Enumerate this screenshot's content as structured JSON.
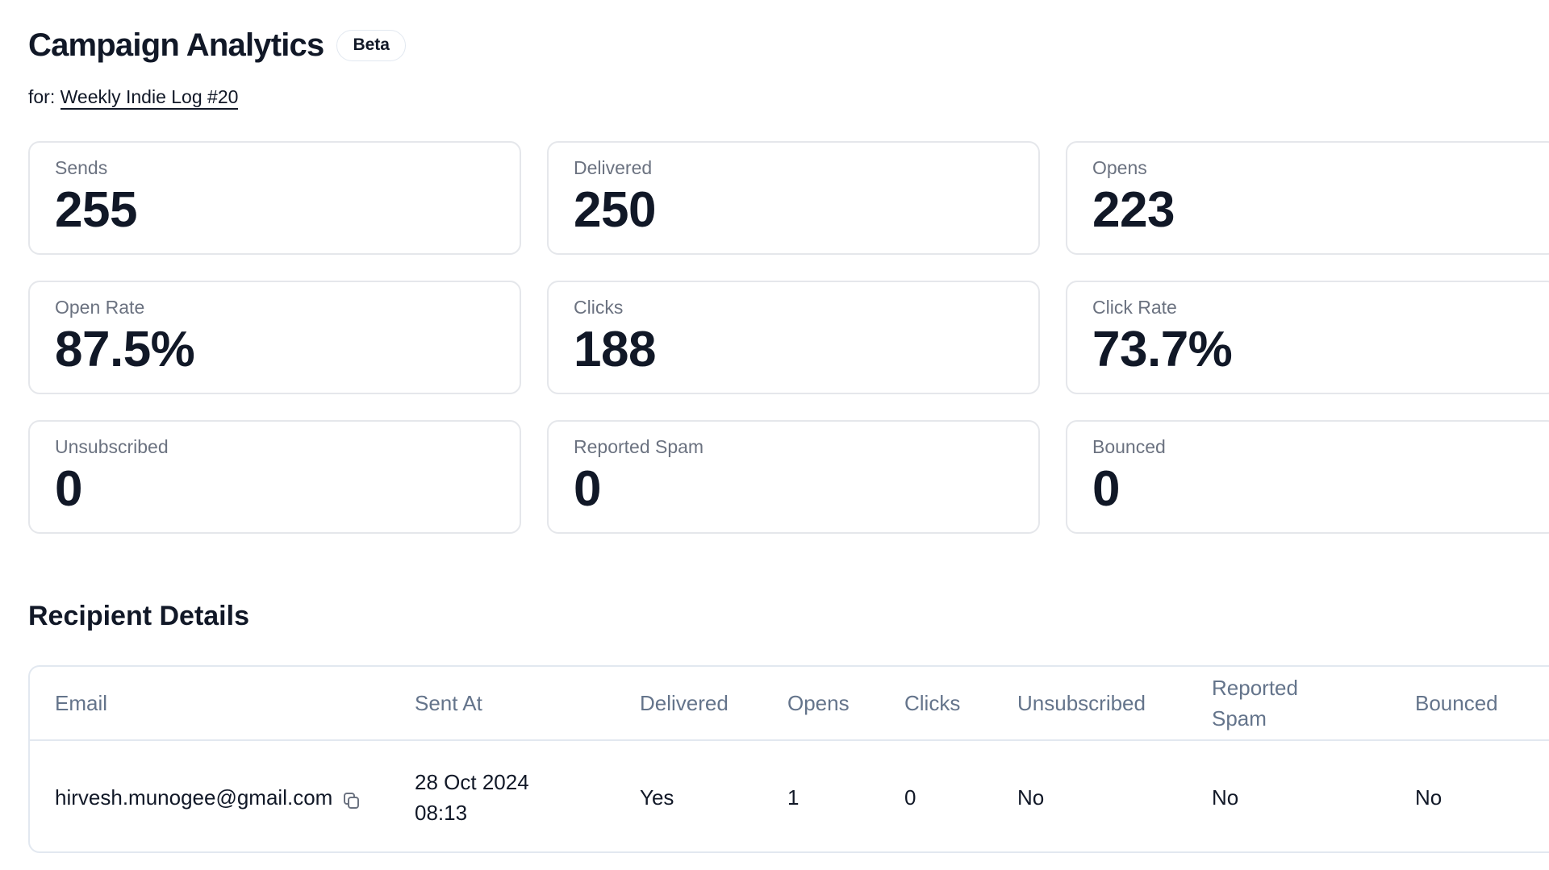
{
  "header": {
    "title": "Campaign Analytics",
    "badge": "Beta",
    "for_prefix": "for:",
    "campaign_link": "Weekly Indie Log #20"
  },
  "stats": [
    {
      "label": "Sends",
      "value": "255"
    },
    {
      "label": "Delivered",
      "value": "250"
    },
    {
      "label": "Opens",
      "value": "223"
    },
    {
      "label": "Open Rate",
      "value": "87.5%"
    },
    {
      "label": "Clicks",
      "value": "188"
    },
    {
      "label": "Click Rate",
      "value": "73.7%"
    },
    {
      "label": "Unsubscribed",
      "value": "0"
    },
    {
      "label": "Reported Spam",
      "value": "0"
    },
    {
      "label": "Bounced",
      "value": "0"
    }
  ],
  "recipients": {
    "title": "Recipient Details",
    "columns": [
      "Email",
      "Sent At",
      "Delivered",
      "Opens",
      "Clicks",
      "Unsubscribed",
      "Reported Spam",
      "Bounced"
    ],
    "rows": [
      {
        "email": "hirvesh.munogee@gmail.com",
        "copy_icon": "copy-icon",
        "sent_at_date": "28 Oct 2024",
        "sent_at_time": "08:13",
        "delivered": "Yes",
        "opens": "1",
        "clicks": "0",
        "unsubscribed": "No",
        "reported_spam": "No",
        "bounced": "No"
      }
    ]
  },
  "colors": {
    "text_primary": "#111827",
    "label_gray": "#6b7280",
    "header_slate": "#64748b",
    "border": "#e2e8f0"
  }
}
